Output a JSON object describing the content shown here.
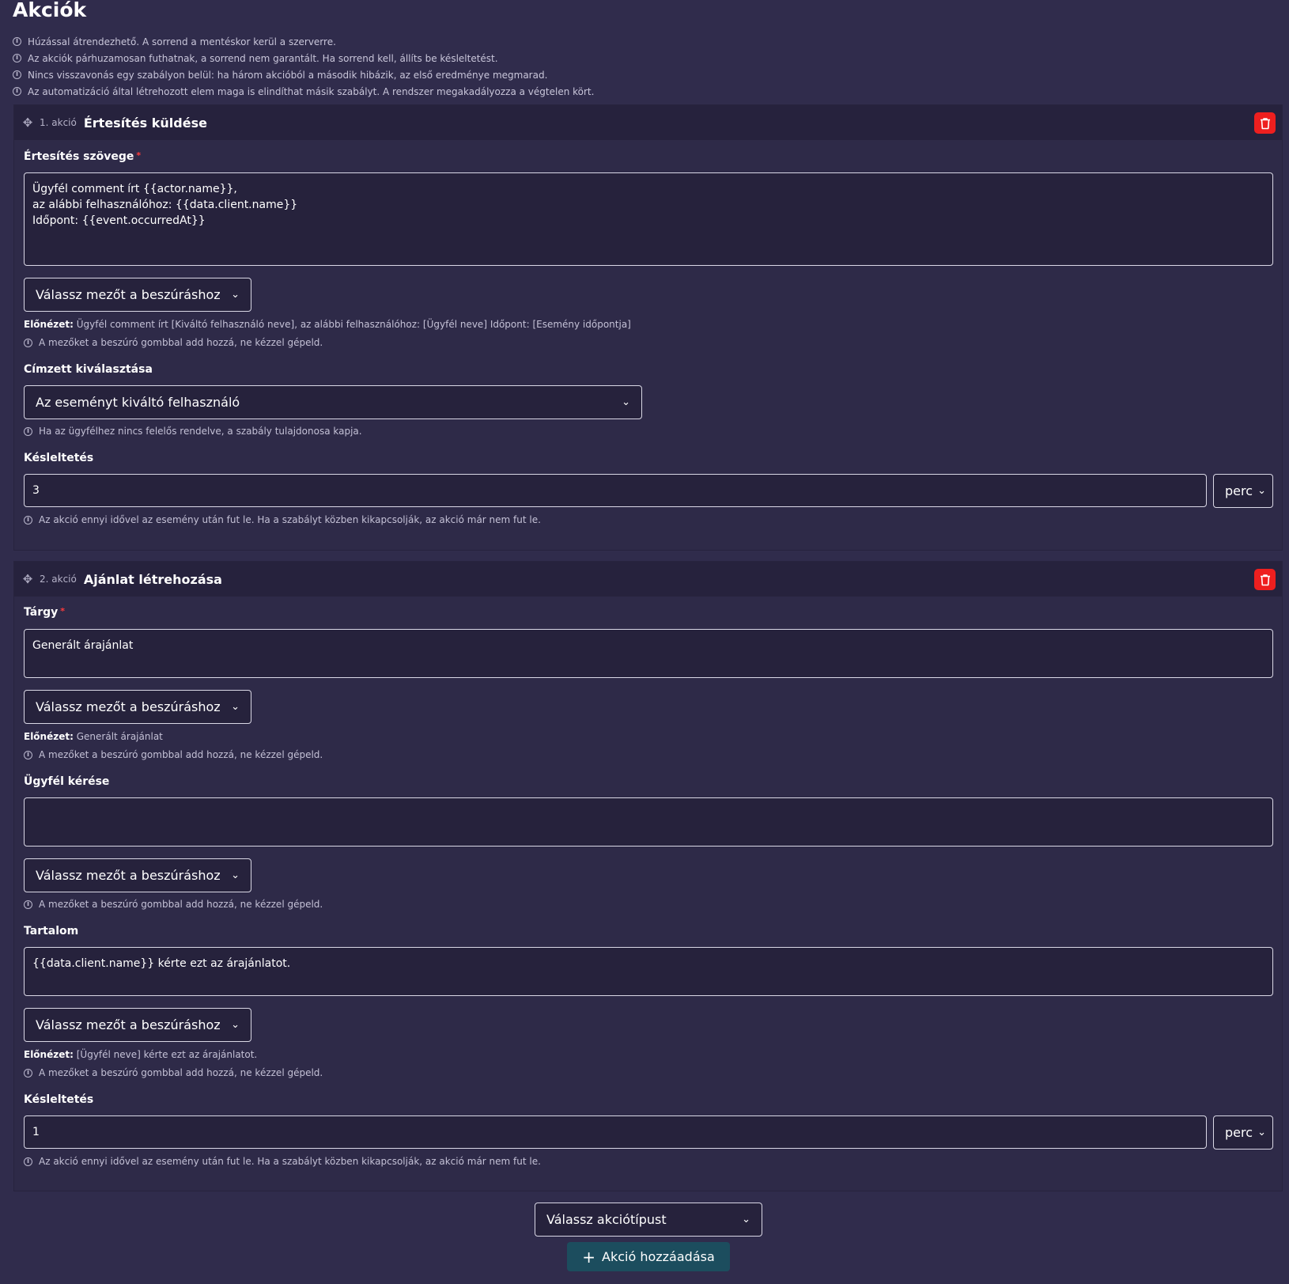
{
  "page": {
    "title": "Akciók"
  },
  "notes": [
    "Húzással átrendezhető. A sorrend a mentéskor kerül a szerverre.",
    "Az akciók párhuzamosan futhatnak, a sorrend nem garantált. Ha sorrend kell, állíts be késleltetést.",
    "Nincs visszavonás egy szabályon belül: ha három akcióból a második hibázik, az első eredménye megmarad.",
    "Az automatizáció által létrehozott elem maga is elindíthat másik szabályt. A rendszer megakadályozza a végtelen kört."
  ],
  "common": {
    "insert_placeholder": "Válassz mezőt a beszúráshoz",
    "insert_hint": "A mezőket a beszúró gombbal add hozzá, ne kézzel gépeld.",
    "preview_label": "Előnézet:",
    "delay_label": "Késleltetés",
    "delay_hint": "Az akció ennyi idővel az esemény után fut le. Ha a szabályt közben kikapcsolják, az akció már nem fut le.",
    "unit": "perc",
    "required_mark": "*"
  },
  "action1": {
    "index": "1. akció",
    "title": "Értesítés küldése",
    "text_label": "Értesítés szövege",
    "text_value": "Ügyfél comment írt {{actor.name}},\naz alábbi felhasználóhoz: {{data.client.name}}\nIdőpont: {{event.occurredAt}}",
    "preview": "Ügyfél comment írt [Kiváltó felhasználó neve], az alábbi felhasználóhoz: [Ügyfél neve] Időpont: [Esemény időpontja]",
    "recipient_label": "Címzett kiválasztása",
    "recipient_value": "Az eseményt kiváltó felhasználó",
    "recipient_hint": "Ha az ügyfélhez nincs felelős rendelve, a szabály tulajdonosa kapja.",
    "delay_value": "3"
  },
  "action2": {
    "index": "2. akció",
    "title": "Ajánlat létrehozása",
    "subject_label": "Tárgy",
    "subject_value": "Generált árajánlat",
    "subject_preview": "Generált árajánlat",
    "request_label": "Ügyfél kérése",
    "request_value": "",
    "content_label": "Tartalom",
    "content_value": "{{data.client.name}} kérte ezt az árajánlatot.",
    "content_preview": "[Ügyfél neve] kérte ezt az árajánlatot.",
    "delay_value": "1"
  },
  "footer": {
    "action_type_placeholder": "Válassz akciótípust",
    "add_button": "Akció hozzáadása"
  },
  "colors": {
    "background": "#302c4c",
    "delete": "#ee1f1f",
    "add_button": "#1c4d5e"
  },
  "icons": {
    "info": "info-icon",
    "drag": "drag-handle-icon",
    "delete": "trash-icon",
    "chevron": "chevron-down-icon",
    "add": "plus-icon"
  }
}
